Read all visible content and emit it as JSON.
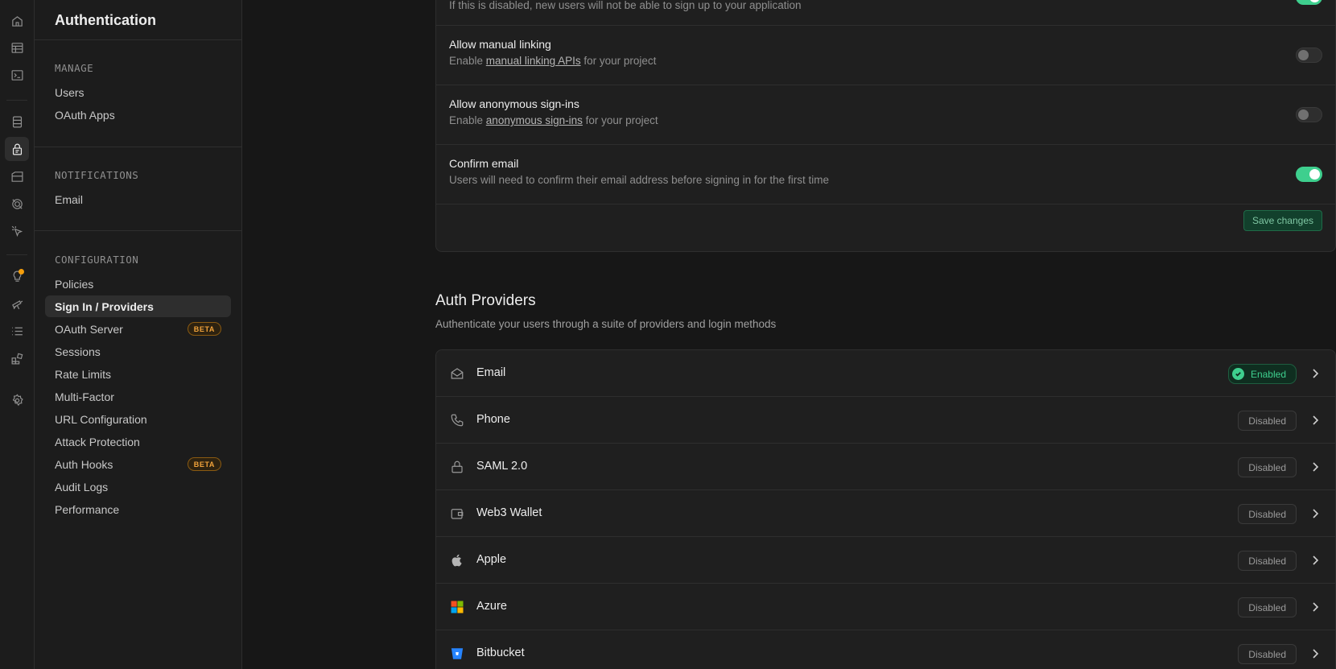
{
  "sidebar": {
    "title": "Authentication",
    "sections": [
      {
        "heading": "MANAGE",
        "items": [
          "Users",
          "OAuth Apps"
        ]
      },
      {
        "heading": "NOTIFICATIONS",
        "items": [
          "Email"
        ]
      },
      {
        "heading": "CONFIGURATION",
        "items": [
          "Policies",
          "Sign In / Providers",
          "OAuth Server",
          "Sessions",
          "Rate Limits",
          "Multi-Factor",
          "URL Configuration",
          "Attack Protection",
          "Auth Hooks",
          "Audit Logs",
          "Performance"
        ]
      }
    ],
    "active_item": "Sign In / Providers",
    "beta_label": "BETA"
  },
  "rail_icons": [
    "home-icon",
    "table-editor-icon",
    "sql-editor-icon",
    "database-icon",
    "authentication-icon",
    "storage-icon",
    "realtime-icon",
    "edge-functions-icon",
    "advisors-icon",
    "observability-icon",
    "logs-icon",
    "integrations-icon",
    "settings-icon"
  ],
  "settings": {
    "truncated_desc": "If this is disabled, new users will not be able to sign up to your application",
    "rows": [
      {
        "title": "Allow manual linking",
        "desc_prefix": "Enable ",
        "link": "manual linking APIs",
        "desc_suffix": " for your project",
        "enabled": false
      },
      {
        "title": "Allow anonymous sign-ins",
        "desc_prefix": "Enable ",
        "link": "anonymous sign-ins",
        "desc_suffix": " for your project",
        "enabled": false
      },
      {
        "title": "Confirm email",
        "desc": "Users will need to confirm their email address before signing in for the first time",
        "enabled": true
      }
    ],
    "save_label": "Save changes"
  },
  "providers": {
    "title": "Auth Providers",
    "subtitle": "Authenticate your users through a suite of providers and login methods",
    "items": [
      {
        "name": "Email",
        "status": "Enabled"
      },
      {
        "name": "Phone",
        "status": "Disabled"
      },
      {
        "name": "SAML 2.0",
        "status": "Disabled"
      },
      {
        "name": "Web3 Wallet",
        "status": "Disabled"
      },
      {
        "name": "Apple",
        "status": "Disabled"
      },
      {
        "name": "Azure",
        "status": "Disabled"
      },
      {
        "name": "Bitbucket",
        "status": "Disabled"
      }
    ]
  },
  "colors": {
    "accent": "#3ecf8e",
    "beta": "#f1a33b",
    "background": "#171717"
  }
}
